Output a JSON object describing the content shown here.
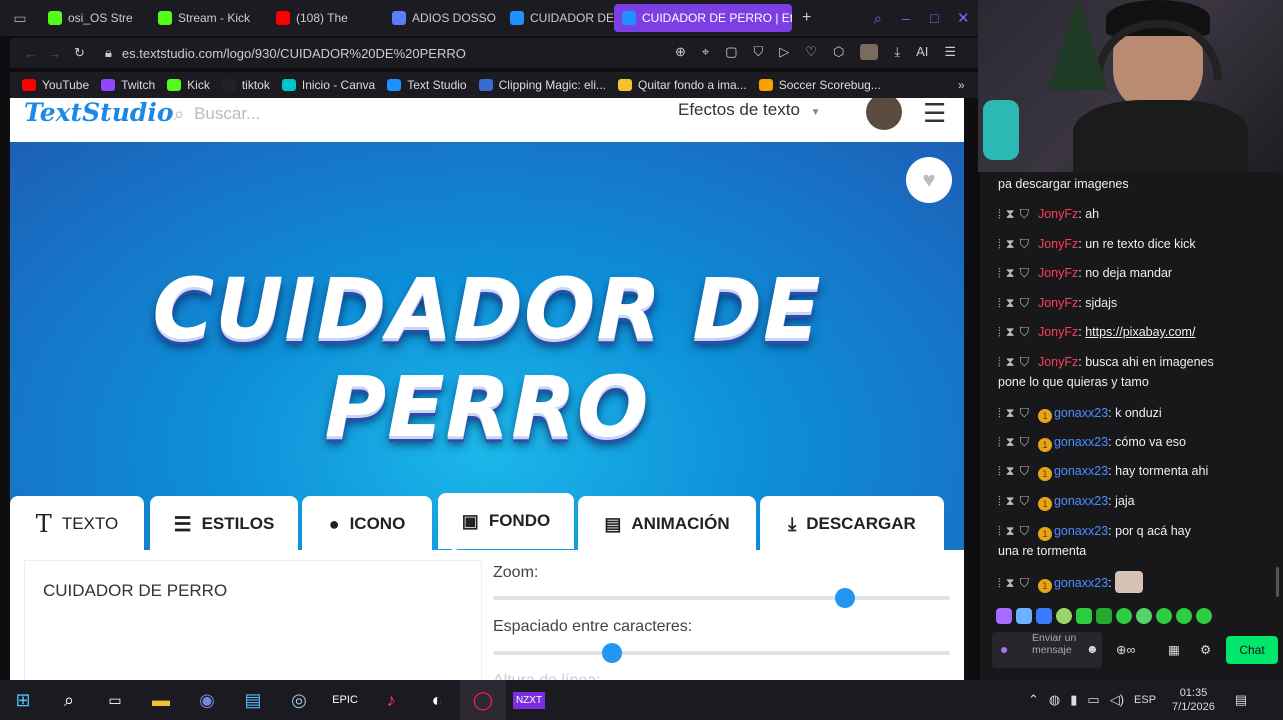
{
  "browser": {
    "tabs": [
      {
        "title": "osi_OS Stre",
        "color": "#53fc18"
      },
      {
        "title": "Stream - Kick",
        "color": "#53fc18"
      },
      {
        "title": "(108) The",
        "color": "#ff0000"
      },
      {
        "title": "ADIOS DOSSO",
        "color": "#5b7cff"
      },
      {
        "title": "CUIDADOR DE",
        "color": "#1e90ff"
      },
      {
        "title": "CUIDADOR DE PERRO | Et",
        "color": "#1e90ff"
      }
    ],
    "url": "es.textstudio.com/logo/930/CUIDADOR%20DE%20PERRO",
    "ai_label": "AI",
    "bookmarks": [
      {
        "label": "YouTube",
        "color": "#ff0000"
      },
      {
        "label": "Twitch",
        "color": "#9146ff"
      },
      {
        "label": "Kick",
        "color": "#53fc18"
      },
      {
        "label": "tiktok",
        "color": "#222222"
      },
      {
        "label": "Inicio - Canva",
        "color": "#00c4cc"
      },
      {
        "label": "Text Studio",
        "color": "#1e90ff"
      },
      {
        "label": "Clipping Magic: eli...",
        "color": "#3a6ccf"
      },
      {
        "label": "Quitar fondo a ima...",
        "color": "#f4c430"
      },
      {
        "label": "Soccer Scorebug...",
        "color": "#f4a300"
      }
    ]
  },
  "site": {
    "logo": "TextStudio",
    "search_placeholder": "Buscar...",
    "effects_label": "Efectos de texto",
    "hero_text": "CUIDADOR DE PERRO",
    "tools": [
      "TEXTO",
      "ESTILOS",
      "ICONO",
      "FONDO",
      "ANIMACIÓN",
      "DESCARGAR"
    ],
    "text_value": "CUIDADOR DE PERRO",
    "zoom_label": "Zoom:",
    "zoom_level": 0.77,
    "spacing_label": "Espaciado entre caracteres:",
    "spacing_level": 0.26,
    "next_label": "Altura de línea:"
  },
  "chat": {
    "top_line": "pa descargar imagenes",
    "messages": [
      {
        "user": "JonyFz",
        "text": "ah",
        "type": "j"
      },
      {
        "user": "JonyFz",
        "text": "un re texto dice kick",
        "type": "j"
      },
      {
        "user": "JonyFz",
        "text": "no deja mandar",
        "type": "j"
      },
      {
        "user": "JonyFz",
        "text": "sjdajs",
        "type": "j"
      },
      {
        "user": "JonyFz",
        "text": "https://pixabay.com/",
        "type": "j",
        "link": true
      },
      {
        "user": "JonyFz",
        "text": "busca ahi en imagenes",
        "cont": "pone lo que quieras y tamo",
        "type": "j"
      },
      {
        "user": "gonaxx23",
        "text": "k onduzi",
        "type": "g"
      },
      {
        "user": "gonaxx23",
        "text": "cómo va eso",
        "type": "g"
      },
      {
        "user": "gonaxx23",
        "text": "hay tormenta ahi",
        "type": "g"
      },
      {
        "user": "gonaxx23",
        "text": "jaja",
        "type": "g"
      },
      {
        "user": "gonaxx23",
        "text": "por q acá hay",
        "cont": "una re tormenta",
        "type": "g"
      },
      {
        "user": "gonaxx23",
        "text": "",
        "type": "g",
        "emote": true
      }
    ],
    "input_placeholder": "Enviar un mensaje",
    "chat_button": "Chat"
  },
  "taskbar": {
    "lang": "ESP",
    "time": "01:35",
    "date": "7/1/2026"
  }
}
